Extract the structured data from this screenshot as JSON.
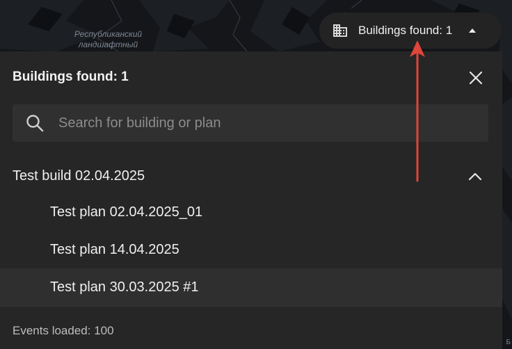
{
  "map": {
    "label_lines": [
      "Республиканский",
      "ландшафтный"
    ],
    "corner_label": "Б"
  },
  "pill": {
    "text": "Buildings found: 1",
    "icon": "building-icon",
    "caret_icon": "caret-up-icon"
  },
  "panel": {
    "title": "Buildings found: 1",
    "close_icon": "close-icon",
    "search": {
      "placeholder": "Search for building or plan",
      "value": ""
    },
    "buildings": [
      {
        "name": "Test build 02.04.2025",
        "expanded": true,
        "plans": [
          {
            "name": "Test plan 02.04.2025_01",
            "selected": false
          },
          {
            "name": "Test plan 14.04.2025",
            "selected": false
          },
          {
            "name": "Test plan 30.03.2025 #1",
            "selected": true
          }
        ]
      }
    ],
    "status": "Events loaded: 100"
  },
  "colors": {
    "panel_bg": "#262626",
    "pill_bg": "#232323",
    "search_bg": "#303030",
    "selected_row_bg": "#2f2f2f",
    "annotation_arrow": "#e0453a"
  }
}
